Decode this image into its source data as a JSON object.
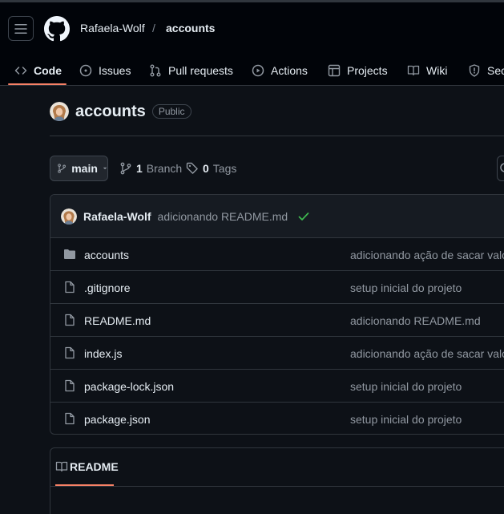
{
  "header": {
    "owner": "Rafaela-Wolf",
    "separator": "/",
    "repo": "accounts"
  },
  "tabs": [
    {
      "label": "Code",
      "icon": "code-icon",
      "active": true
    },
    {
      "label": "Issues",
      "icon": "issue-icon"
    },
    {
      "label": "Pull requests",
      "icon": "pull-request-icon"
    },
    {
      "label": "Actions",
      "icon": "play-icon"
    },
    {
      "label": "Projects",
      "icon": "table-icon"
    },
    {
      "label": "Wiki",
      "icon": "book-icon"
    },
    {
      "label": "Sec",
      "icon": "shield-icon"
    }
  ],
  "repo": {
    "title": "accounts",
    "visibility": "Public"
  },
  "branch": {
    "name": "main",
    "branch_count": "1",
    "branch_label": "Branch",
    "tag_count": "0",
    "tag_label": "Tags"
  },
  "commit": {
    "author": "Rafaela-Wolf",
    "message": "adicionando README.md",
    "status": "success"
  },
  "files": [
    {
      "name": "accounts",
      "type": "folder",
      "message": "adicionando ação de sacar valo"
    },
    {
      "name": ".gitignore",
      "type": "file",
      "message": "setup inicial do projeto"
    },
    {
      "name": "README.md",
      "type": "file",
      "message": "adicionando README.md"
    },
    {
      "name": "index.js",
      "type": "file",
      "message": "adicionando ação de sacar valo"
    },
    {
      "name": "package-lock.json",
      "type": "file",
      "message": "setup inicial do projeto"
    },
    {
      "name": "package.json",
      "type": "file",
      "message": "setup inicial do projeto"
    }
  ],
  "readme": {
    "tab_label": "README"
  },
  "colors": {
    "accent": "#f78166",
    "success": "#3fb950",
    "background": "#0d1117",
    "header_bg": "#010409"
  }
}
